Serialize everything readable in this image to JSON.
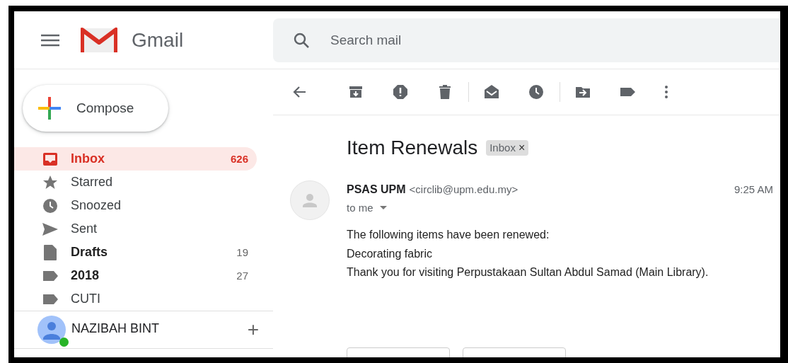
{
  "header": {
    "logo_text": "Gmail",
    "search": {
      "placeholder": "Search mail"
    }
  },
  "compose": {
    "label": "Compose"
  },
  "nav": [
    {
      "kind": "inbox",
      "label": "Inbox",
      "count": "626",
      "selected": true,
      "unread": true
    },
    {
      "kind": "star",
      "label": "Starred",
      "selected": false,
      "unread": false
    },
    {
      "kind": "clock",
      "label": "Snoozed",
      "selected": false,
      "unread": false
    },
    {
      "kind": "send",
      "label": "Sent",
      "selected": false,
      "unread": false
    },
    {
      "kind": "draft",
      "label": "Drafts",
      "count": "19",
      "selected": false,
      "unread": true
    },
    {
      "kind": "label",
      "label": "2018",
      "count": "27",
      "selected": false,
      "unread": true
    },
    {
      "kind": "label",
      "label": "CUTI",
      "selected": false,
      "unread": false
    }
  ],
  "account": {
    "name": "NAZIBAH BINT",
    "online": true,
    "add": "+"
  },
  "message": {
    "subject": "Item Renewals",
    "chip": {
      "label": "Inbox",
      "remove": "×"
    },
    "sender": "PSAS UPM",
    "email": "<circlib@upm.edu.my>",
    "time": "9:25 AM",
    "recipient": "to me",
    "body": [
      "The following items have been renewed:",
      "Decorating fabric",
      "Thank you for visiting Perpustakaan Sultan Abdul Samad (Main Library)."
    ]
  }
}
